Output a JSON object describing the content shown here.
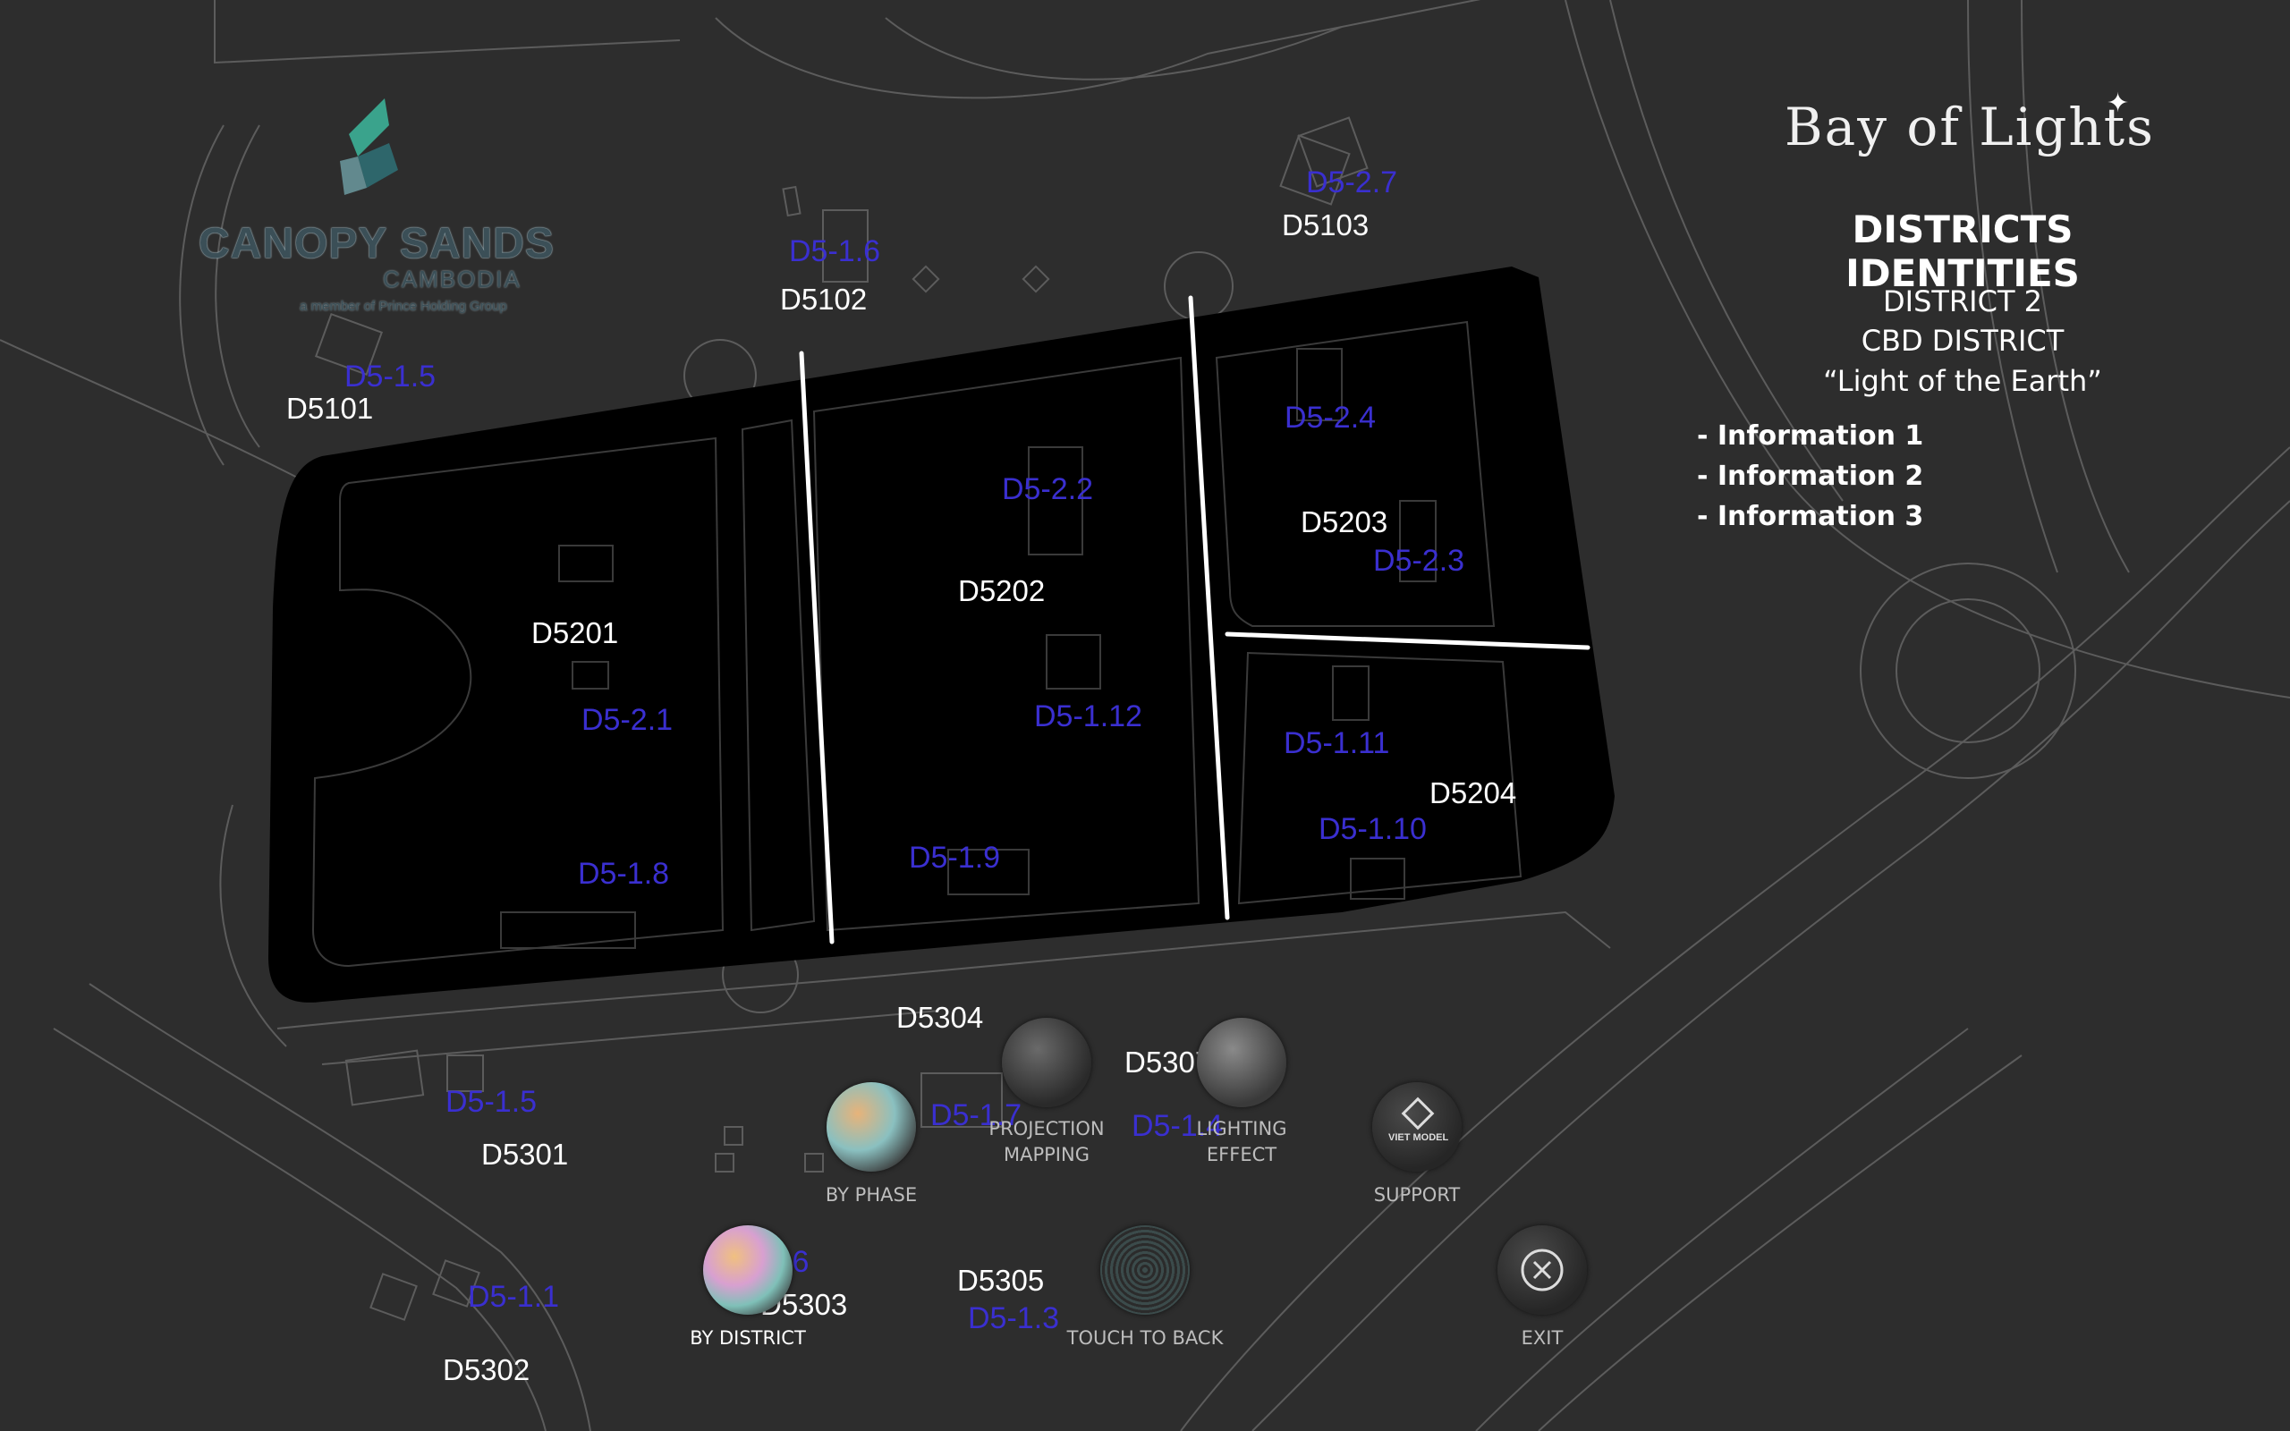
{
  "brand": {
    "name": "Bay of Lights"
  },
  "logo": {
    "name": "CANOPY SANDS",
    "subtitle": "CAMBODIA",
    "tagline": "a member of Prince Holding Group"
  },
  "panel": {
    "title": "DISTRICTS IDENTITIES",
    "district": "DISTRICT 2",
    "district_name": "CBD DISTRICT",
    "motto": "“Light of the Earth”",
    "info": [
      "- Information 1",
      "- Information 2",
      "- Information 3"
    ]
  },
  "district_codes": [
    "D5101",
    "D5102",
    "D5103",
    "D5201",
    "D5202",
    "D5203",
    "D5204",
    "D5301",
    "D5302",
    "D5303",
    "D5304",
    "D5305",
    "D5307"
  ],
  "plot_codes": [
    "D5-1.5",
    "D5-1.6",
    "D5-2.7",
    "D5-2.2",
    "D5-2.4",
    "D5-2.3",
    "D5-2.1",
    "D5-1.12",
    "D5-1.11",
    "D5-1.10",
    "D5-1.8",
    "D5-1.9",
    "D5-1.5",
    "D5-1.7",
    "D5-1.4",
    "D5-1.1",
    "D5-1.3",
    ".6"
  ],
  "menu": {
    "by_phase": "BY PHASE",
    "projection_1": "PROJECTION",
    "projection_2": "MAPPING",
    "lighting_1": "LIGHTING",
    "lighting_2": "EFFECT",
    "support": "SUPPORT",
    "support_logo": "VIET MODEL",
    "by_district": "BY DISTRICT",
    "touch_to_back": "TOUCH TO BACK",
    "exit": "EXIT"
  },
  "colors": {
    "background": "#2d2d2d",
    "highlight": "#000000",
    "plot_label": "#3a2fd0",
    "text": "#ffffff"
  },
  "icons": {
    "exit": "close-circle-icon",
    "star": "sparkle-icon"
  }
}
